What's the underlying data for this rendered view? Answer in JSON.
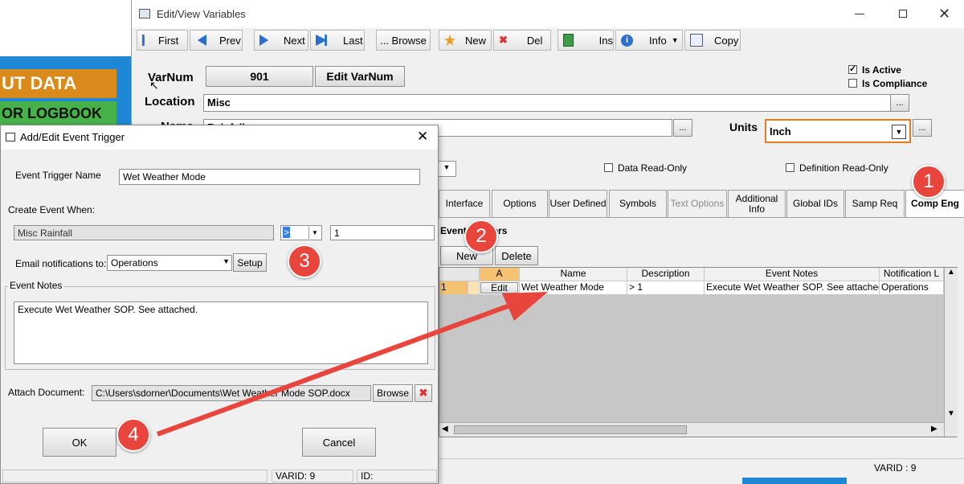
{
  "background": {
    "banner1": "UT DATA",
    "banner2": "OR LOGBOOK"
  },
  "main_window": {
    "title": "Edit/View Variables",
    "toolbar": {
      "first": "First",
      "prev": "Prev",
      "next": "Next",
      "last": "Last",
      "browse": "... Browse",
      "new": "New",
      "del": "Del",
      "ins": "Ins",
      "info": "Info",
      "copy": "Copy"
    },
    "varnum_label": "VarNum",
    "varnum_value": "901",
    "edit_varnum": "Edit VarNum",
    "location_label": "Location",
    "location_value": "Misc",
    "name_label": "Name",
    "name_value": "Rainfall",
    "units_label": "Units",
    "units_value": "Inch",
    "is_active": "Is Active",
    "is_compliance": "Is Compliance",
    "data_readonly": "Data Read-Only",
    "definition_readonly": "Definition Read-Only",
    "ellipsis": "...",
    "tabs": [
      "Interface",
      "Options",
      "User Defined",
      "Symbols",
      "Text Options",
      "Additional Info",
      "Global IDs",
      "Samp Req",
      "Comp Eng"
    ],
    "group_title": "Event Triggers",
    "new_button": "New",
    "delete_button": "Delete",
    "grid": {
      "col_a": "A",
      "headers": [
        "Name",
        "Description",
        "Event Notes",
        "Notification L"
      ],
      "row_num": "1",
      "edit": "Edit",
      "name": "Wet Weather Mode",
      "description": "> 1",
      "notes": "Execute Wet Weather SOP.  See attached",
      "notification": "Operations"
    },
    "status_varid": "VARID : 9"
  },
  "dialog": {
    "title": "Add/Edit Event Trigger",
    "trigger_name_label": "Event Trigger Name",
    "trigger_name_value": "Wet Weather Mode",
    "create_when_label": "Create Event When:",
    "condition_variable": "Misc Rainfall",
    "operator": ">",
    "threshold": "1",
    "email_label": "Email notifications to:",
    "email_value": "Operations",
    "setup": "Setup",
    "notes_label": "Event Notes",
    "notes_value": "Execute Wet Weather SOP.  See attached.",
    "attach_label": "Attach Document:",
    "attach_path": "C:\\Users\\sdorner\\Documents\\Wet Weather Mode SOP.docx",
    "browse": "Browse",
    "ok": "OK",
    "cancel": "Cancel",
    "status_varid": "VARID: 9",
    "status_id": "ID:"
  },
  "callouts": [
    "1",
    "2",
    "3",
    "4"
  ],
  "colors": {
    "callout": "#e8453c",
    "arrow": "#e8453c",
    "banner_orange": "#d98a1a",
    "banner_green": "#47b24a",
    "highlight_orange": "#e07b20"
  }
}
